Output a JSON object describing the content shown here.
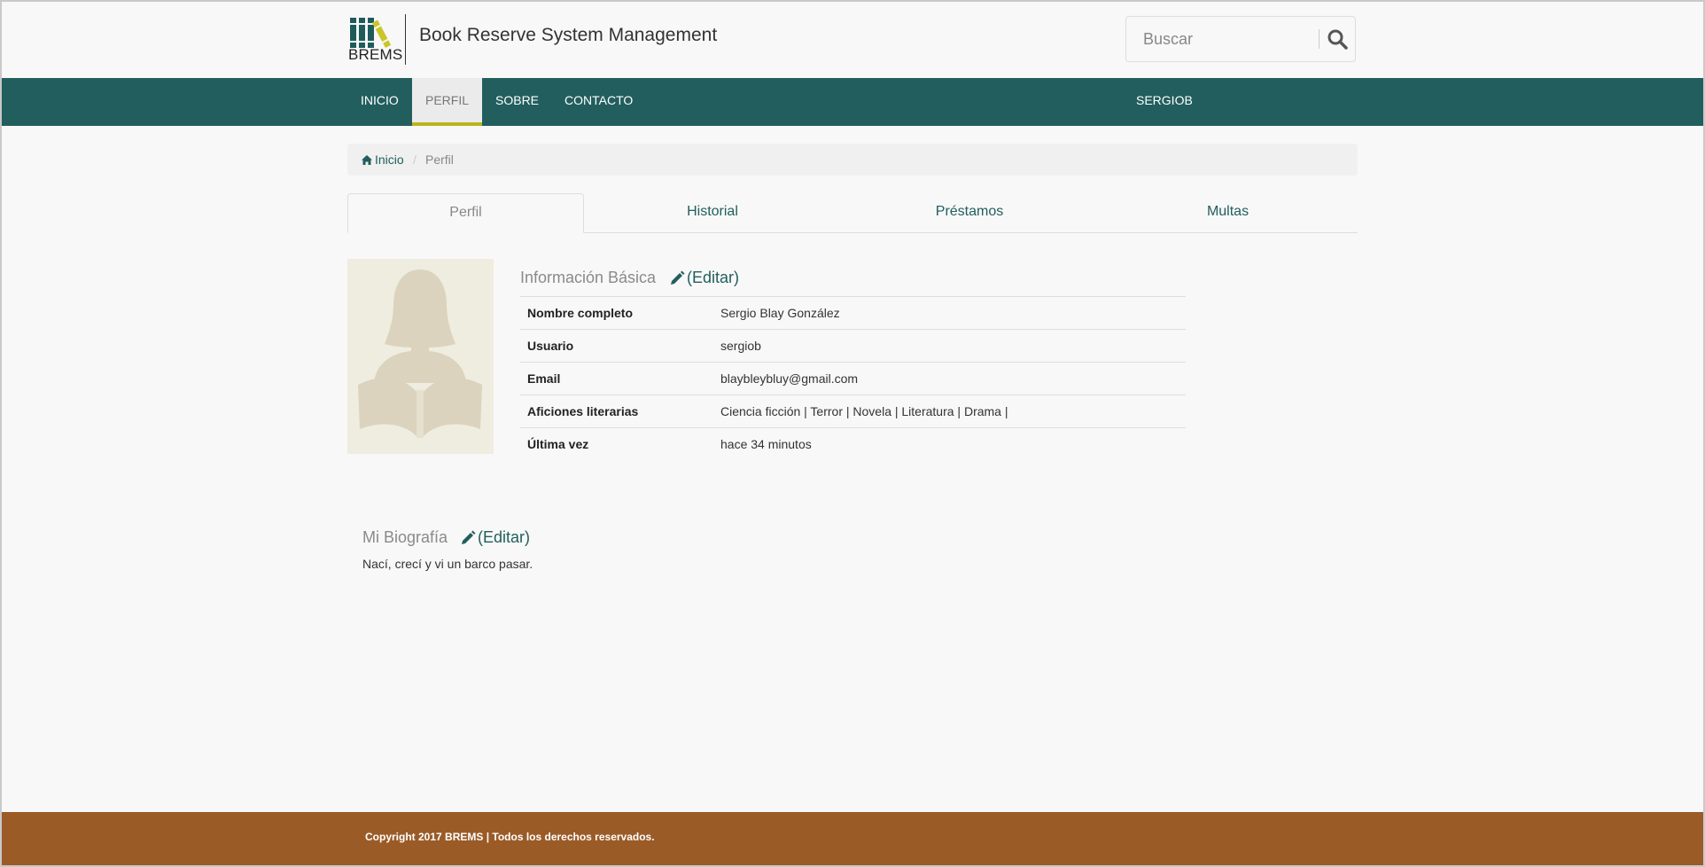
{
  "header": {
    "logo_text": "BREMS",
    "site_title": "Book Reserve System Management",
    "search_placeholder": "Buscar"
  },
  "nav": {
    "items": [
      {
        "label": "INICIO"
      },
      {
        "label": "PERFIL"
      },
      {
        "label": "SOBRE"
      },
      {
        "label": "CONTACTO"
      }
    ],
    "user": "SERGIOB"
  },
  "breadcrumb": {
    "home": "Inicio",
    "separator": "/",
    "current": "Perfil"
  },
  "tabs": [
    {
      "label": "Perfil"
    },
    {
      "label": "Historial"
    },
    {
      "label": "Préstamos"
    },
    {
      "label": "Multas"
    }
  ],
  "basic_info": {
    "title": "Información Básica",
    "edit_label": "(Editar)",
    "rows": [
      {
        "key": "Nombre completo",
        "value": "Sergio Blay González"
      },
      {
        "key": "Usuario",
        "value": "sergiob"
      },
      {
        "key": "Email",
        "value": "blaybleybluy@gmail.com"
      },
      {
        "key": "Aficiones literarias",
        "value": "Ciencia ficción | Terror | Novela | Literatura | Drama |"
      },
      {
        "key": "Última vez",
        "value": "hace 34 minutos"
      }
    ]
  },
  "biography": {
    "title": "Mi Biografía",
    "edit_label": "(Editar)",
    "text": "Nací, crecí y vi un barco pasar."
  },
  "footer": {
    "copyright": "Copyright 2017 BREMS | Todos los derechos reservados."
  },
  "colors": {
    "nav_bg": "#225e5e",
    "accent": "#b9b61e",
    "footer_bg": "#9a5b27",
    "link": "#225e5e"
  }
}
